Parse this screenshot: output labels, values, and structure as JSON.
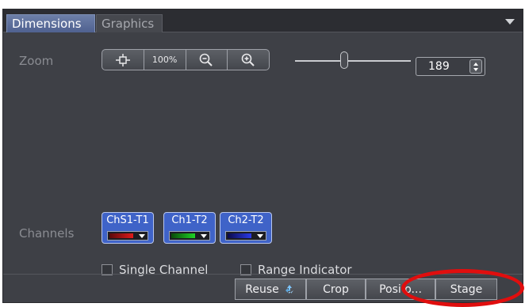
{
  "tabs": [
    {
      "label": "Dimensions",
      "active": true
    },
    {
      "label": "Graphics",
      "active": false
    }
  ],
  "zoom": {
    "label": "Zoom",
    "buttons": {
      "fit_icon": "fit-to-window-icon",
      "hundred": "100%",
      "zoom_out_icon": "zoom-out-icon",
      "zoom_in_icon": "zoom-in-icon"
    },
    "slider_value": "189"
  },
  "channels": {
    "label": "Channels",
    "items": [
      {
        "label": "ChS1-T1",
        "color": "#c01818"
      },
      {
        "label": "Ch1-T2",
        "color": "#18b420"
      },
      {
        "label": "Ch2-T2",
        "color": "#2828c8"
      }
    ],
    "single_channel_label": "Single Channel",
    "range_indicator_label": "Range Indicator"
  },
  "bottom_buttons": {
    "reuse": "Reuse",
    "crop": "Crop",
    "position": "Posi o...",
    "stage": "Stage"
  },
  "colors": {
    "highlight": "#e00e0e",
    "active_tab": "#5a6c9c",
    "channel_button": "#3f63c8"
  }
}
